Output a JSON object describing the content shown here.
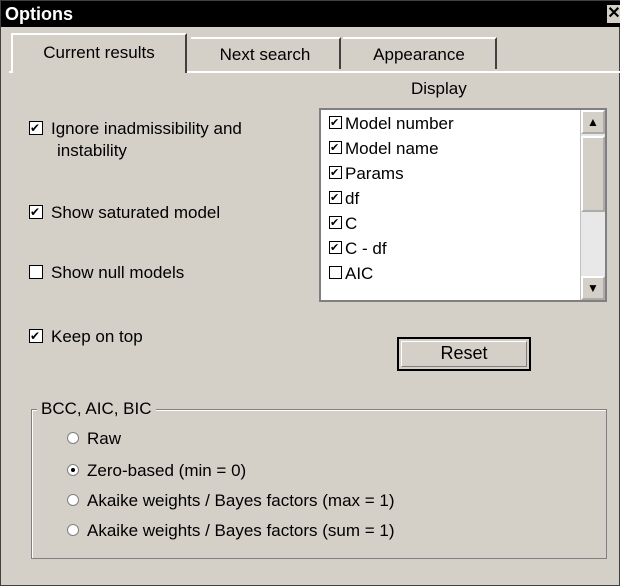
{
  "window": {
    "title": "Options",
    "close_glyph": "✕"
  },
  "tabs": [
    {
      "label": "Current results",
      "active": true
    },
    {
      "label": "Next search",
      "active": false
    },
    {
      "label": "Appearance",
      "active": false
    }
  ],
  "left_checks": [
    {
      "line1": "Ignore inadmissibility and",
      "line2": "instability",
      "checked": true
    },
    {
      "label": "Show saturated model",
      "checked": true
    },
    {
      "label": "Show null models",
      "checked": false
    },
    {
      "label": "Keep on top",
      "checked": true
    }
  ],
  "display": {
    "label": "Display",
    "items": [
      {
        "label": "Model number",
        "checked": true
      },
      {
        "label": "Model name",
        "checked": true
      },
      {
        "label": "Params",
        "checked": true
      },
      {
        "label": "df",
        "checked": true
      },
      {
        "label": "C",
        "checked": true
      },
      {
        "label": "C - df",
        "checked": true
      },
      {
        "label": "AIC",
        "checked": false
      }
    ]
  },
  "reset_label": "Reset",
  "group": {
    "label": "BCC, AIC, BIC",
    "options": [
      {
        "label": "Raw",
        "selected": false
      },
      {
        "label": "Zero-based (min = 0)",
        "selected": true
      },
      {
        "label": "Akaike weights / Bayes factors (max = 1)",
        "selected": false
      },
      {
        "label": "Akaike weights / Bayes factors (sum = 1)",
        "selected": false
      }
    ]
  }
}
